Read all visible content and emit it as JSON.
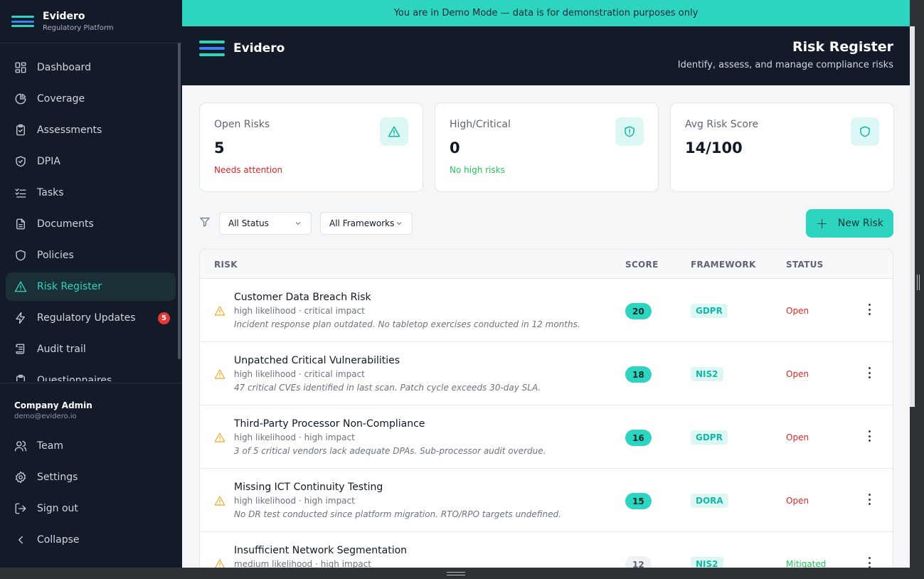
{
  "app": {
    "name": "Evidero",
    "tagline": "Regulatory Platform"
  },
  "colors": {
    "accent": "#2dd4bf",
    "sidebar_bg": "#131a28",
    "danger": "#e53935",
    "warning": "#f5a623",
    "success": "#22c55e"
  },
  "sidebar": {
    "items": [
      {
        "label": "Dashboard",
        "icon": "dashboard-icon"
      },
      {
        "label": "Coverage",
        "icon": "pie-chart-icon"
      },
      {
        "label": "Assessments",
        "icon": "clipboard-check-icon"
      },
      {
        "label": "DPIA",
        "icon": "shield-check-icon"
      },
      {
        "label": "Tasks",
        "icon": "list-check-icon"
      },
      {
        "label": "Documents",
        "icon": "document-icon"
      },
      {
        "label": "Policies",
        "icon": "shield-icon"
      },
      {
        "label": "Risk Register",
        "icon": "warning-icon",
        "active": true
      },
      {
        "label": "Regulatory Updates",
        "icon": "lightning-icon",
        "badge": "5"
      },
      {
        "label": "Audit trail",
        "icon": "scroll-icon"
      },
      {
        "label": "Questionnaires",
        "icon": "clipboard-icon"
      }
    ],
    "user": {
      "name": "Company Admin",
      "email": "demo@evidero.io"
    },
    "bottom": [
      {
        "label": "Team",
        "icon": "users-icon"
      },
      {
        "label": "Settings",
        "icon": "gear-icon"
      },
      {
        "label": "Sign out",
        "icon": "sign-out-icon"
      },
      {
        "label": "Collapse",
        "icon": "chevron-left-icon"
      }
    ]
  },
  "banner": {
    "text": "You are in Demo Mode — data is for demonstration purposes only"
  },
  "header": {
    "brand": "Evidero",
    "title": "Risk Register",
    "subtitle": "Identify, assess, and manage compliance risks"
  },
  "stats": [
    {
      "label": "Open Risks",
      "value": "5",
      "note": "Needs attention",
      "note_color": "#dc2626",
      "icon": "warning-icon"
    },
    {
      "label": "High/Critical",
      "value": "0",
      "note": "No high risks",
      "note_color": "#22c55e",
      "icon": "shield-alert-icon"
    },
    {
      "label": "Avg Risk Score",
      "value": "14/100",
      "note": "",
      "note_color": "#22c55e",
      "icon": "shield-icon"
    }
  ],
  "filters": {
    "status": "All Status",
    "framework": "All Frameworks",
    "new_button": "New Risk"
  },
  "table": {
    "headers": {
      "risk": "RISK",
      "score": "SCORE",
      "framework": "FRAMEWORK",
      "status": "STATUS"
    },
    "rows": [
      {
        "title": "Customer Data Breach Risk",
        "meta": "high likelihood · critical impact",
        "desc": "Incident response plan outdated. No tabletop exercises conducted in 12 months.",
        "score": "20",
        "framework": "GDPR",
        "status": "Open"
      },
      {
        "title": "Unpatched Critical Vulnerabilities",
        "meta": "high likelihood · critical impact",
        "desc": "47 critical CVEs identified in last scan. Patch cycle exceeds 30-day SLA.",
        "score": "18",
        "framework": "NIS2",
        "status": "Open"
      },
      {
        "title": "Third-Party Processor Non-Compliance",
        "meta": "high likelihood · high impact",
        "desc": "3 of 5 critical vendors lack adequate DPAs. Sub-processor audit overdue.",
        "score": "16",
        "framework": "GDPR",
        "status": "Open"
      },
      {
        "title": "Missing ICT Continuity Testing",
        "meta": "high likelihood · high impact",
        "desc": "No DR test conducted since platform migration. RTO/RPO targets undefined.",
        "score": "15",
        "framework": "DORA",
        "status": "Open"
      },
      {
        "title": "Insufficient Network Segmentation",
        "meta": "medium likelihood · high impact",
        "desc": "",
        "score": "12",
        "framework": "NIS2",
        "status": "Mitigated"
      }
    ]
  }
}
